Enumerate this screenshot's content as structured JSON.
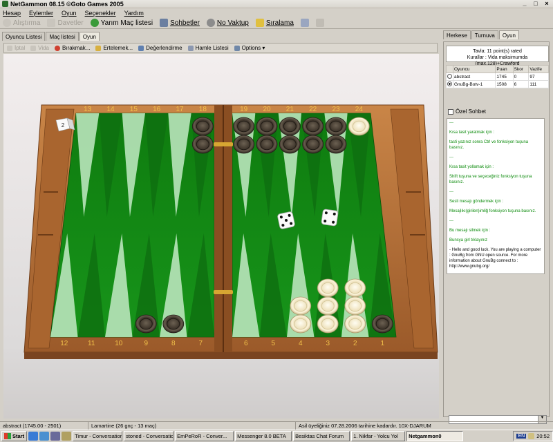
{
  "window": {
    "title": "NetGammon 08.15 ©Goto Games 2005",
    "controls": [
      "_",
      "□",
      "×"
    ]
  },
  "menu": [
    "Hesap",
    "Eylemler",
    "Oyun",
    "Seçenekler",
    "Yardım"
  ],
  "toolbar": {
    "items": [
      {
        "label": "Alıştırma",
        "icon": "practice-icon",
        "enabled": false
      },
      {
        "label": "Davetler",
        "icon": "invitations-icon",
        "enabled": false
      },
      {
        "label": "Yarım Maç listesi",
        "icon": "half-match-icon",
        "enabled": true
      },
      {
        "label": "Sohbetler",
        "icon": "chat-icon",
        "enabled": true
      },
      {
        "label": "No Vaktup",
        "icon": "no-time-icon",
        "enabled": true
      },
      {
        "label": "Sıralama",
        "icon": "ranking-icon",
        "enabled": true
      }
    ]
  },
  "left_tabs": [
    "Oyuncu Listesi",
    "Maç listesi",
    "Oyun"
  ],
  "left_tab_active": 2,
  "sub_toolbar": [
    {
      "label": "İptal",
      "enabled": false
    },
    {
      "label": "Vida",
      "enabled": false
    },
    {
      "label": "Bırakmak...",
      "enabled": true
    },
    {
      "label": "Ertelemek...",
      "enabled": true
    },
    {
      "label": "Değerlendirme",
      "enabled": true
    },
    {
      "label": "Hamle Listesi",
      "enabled": true
    },
    {
      "label": "Options ▾",
      "enabled": true
    }
  ],
  "board": {
    "top_labels": [
      "13",
      "14",
      "15",
      "16",
      "17",
      "18",
      "19",
      "20",
      "21",
      "22",
      "23",
      "24"
    ],
    "bottom_labels": [
      "12",
      "11",
      "10",
      "9",
      "8",
      "7",
      "6",
      "5",
      "4",
      "3",
      "2",
      "1"
    ],
    "cube_value": "2",
    "dice": [
      5,
      4
    ],
    "colors": {
      "felt": "#138a13",
      "felt_dark": "#0b6e0b",
      "wood": "#b26b35",
      "light_point": "#b9e4bb",
      "dark_point": "#0e7010",
      "white_checker": "#efe3bf",
      "dark_checker": "#4e4439"
    },
    "checkers": [
      {
        "point": 18,
        "color": "dark",
        "count": 2
      },
      {
        "point": 19,
        "color": "dark",
        "count": 2
      },
      {
        "point": 20,
        "color": "dark",
        "count": 2
      },
      {
        "point": 21,
        "color": "dark",
        "count": 2
      },
      {
        "point": 22,
        "color": "dark",
        "count": 2
      },
      {
        "point": 23,
        "color": "dark",
        "count": 2
      },
      {
        "point": 24,
        "color": "white",
        "count": 1
      },
      {
        "point": 9,
        "color": "dark",
        "count": 1
      },
      {
        "point": 8,
        "color": "dark",
        "count": 1
      },
      {
        "point": 1,
        "color": "dark",
        "count": 1
      },
      {
        "point": 4,
        "color": "white",
        "count": 2
      },
      {
        "point": 3,
        "color": "white",
        "count": 3
      },
      {
        "point": 2,
        "color": "white",
        "count": 3
      }
    ]
  },
  "right_tabs": [
    "Herkese",
    "Turnuva",
    "Oyun"
  ],
  "right_tab_active": 2,
  "match_info": {
    "line1": "Tavla: 11 point(s) rated",
    "line2": "Kurallar : Vida maksimumda (max.128)+Crawford"
  },
  "players_table": {
    "headers": [
      "",
      "Oyuncu",
      "Puan",
      "Skor",
      "Vazife"
    ],
    "rows": [
      {
        "name": "abstract",
        "rating": "1745",
        "score": "0",
        "other": "97",
        "selected": false
      },
      {
        "name": "GnuBg-Botv-1",
        "rating": "1508",
        "score": "6",
        "other": "111",
        "selected": true
      }
    ]
  },
  "private_chat_label": "Özel Sohbet",
  "chat": [
    {
      "color": "g",
      "text": "---"
    },
    {
      "color": "g",
      "text": "Kısa tasit yaratmak için :"
    },
    {
      "color": "g",
      "text": "tasti yazınız sonra Ctrl ve fonksiyon tuşuna basınız."
    },
    {
      "color": "g",
      "text": "---"
    },
    {
      "color": "g",
      "text": "Kısa tasit yollamak için :"
    },
    {
      "color": "g",
      "text": "Shift tuşuna ve seçeceğiniz fonksiyon tuşuna basınız."
    },
    {
      "color": "g",
      "text": "---"
    },
    {
      "color": "g",
      "text": "Sesli mesajı göndermek için :"
    },
    {
      "color": "g",
      "text": "Mesajlıkı(girilen)imliğ fonksiyon tuşuna basınız."
    },
    {
      "color": "g",
      "text": "---"
    },
    {
      "color": "g",
      "text": "Bu mesajı silmek için :"
    },
    {
      "color": "g",
      "text": "Bunsya girl tıklayınız"
    },
    {
      "color": "b",
      "text": "- Hello and good luck. You are playing a computer : GnuBg from GNU open source. For more information about GnuBg connect to : http://www.gnubg.org/"
    }
  ],
  "status": {
    "player": "abstract (1745.00 - 2501)",
    "opponent": "Lamartine (26 gnç - 13 maç)",
    "membership": "Asil üyeliğiniz 07.28.2006 tarihine kadardır. 10X-DJARUM"
  },
  "taskbar": {
    "start": "Start",
    "tasks": [
      {
        "label": "Timur - Conversation",
        "active": false
      },
      {
        "label": "stoned - Conversation",
        "active": false
      },
      {
        "label": "EmPeRoR - Conver...",
        "active": false
      },
      {
        "label": "Messenger 8.0 BETA",
        "active": false
      },
      {
        "label": "Besiktas Chat Forum",
        "active": false
      },
      {
        "label": "1. Nikfar - Yolcu Yol",
        "active": false
      },
      {
        "label": "Netgammon0",
        "active": true
      }
    ],
    "lang": "EN",
    "time": "20:52"
  }
}
